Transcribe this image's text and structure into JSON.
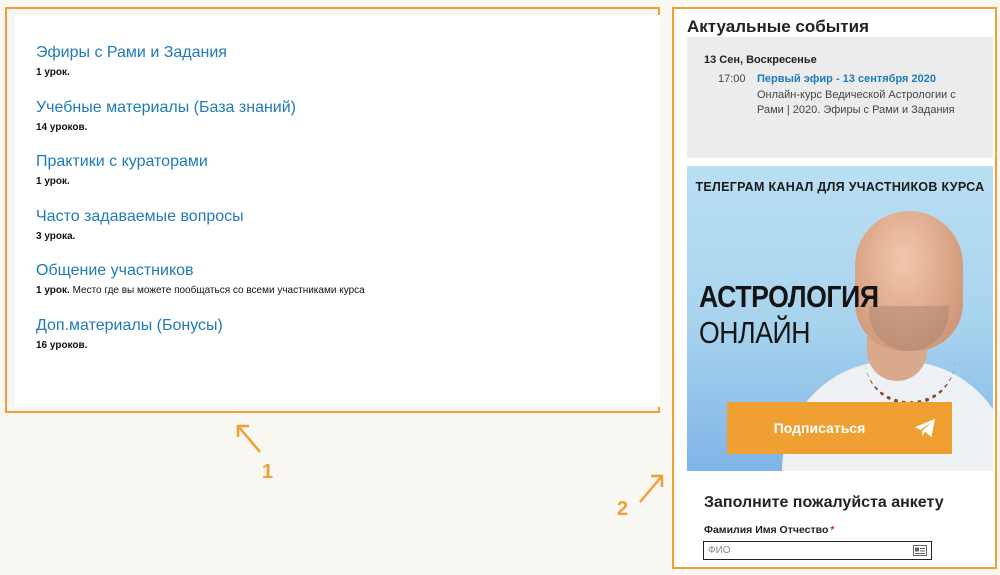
{
  "lessons": [
    {
      "title": "Эфиры с Рами и Задания",
      "count": "1 урок.",
      "desc": ""
    },
    {
      "title": "Учебные материалы (База знаний)",
      "count": "14 уроков.",
      "desc": ""
    },
    {
      "title": "Практики с кураторами",
      "count": "1 урок.",
      "desc": ""
    },
    {
      "title": "Часто задаваемые вопросы",
      "count": "3 урока.",
      "desc": ""
    },
    {
      "title": "Общение участников",
      "count": "1 урок.",
      "desc": "Место где вы можете пообщаться со всеми участниками курса"
    },
    {
      "title": "Доп.материалы (Бонусы)",
      "count": "16 уроков.",
      "desc": ""
    }
  ],
  "events": {
    "title": "Актуальные события",
    "date": "13 Сен, Воскресенье",
    "time": "17:00",
    "link": "Первый эфир - 13 сентября 2020",
    "description": "Онлайн-курс Ведической Астрологии с Рами | 2020. Эфиры с Рами и Задания"
  },
  "banner": {
    "heading": "ТЕЛЕГРАМ КАНАЛ ДЛЯ УЧАСТНИКОВ КУРСА",
    "brand_line1": "АСТРОЛОГИЯ",
    "brand_line2": "ОНЛАЙН",
    "button_label": "Подписаться"
  },
  "form": {
    "title": "Заполните пожалуйста анкету",
    "field_label": "Фамилия Имя Отчество",
    "required_mark": "*",
    "placeholder": "ФИО"
  },
  "annotations": {
    "one": "1",
    "two": "2"
  },
  "colors": {
    "accent": "#f0a033",
    "link": "#1f7ab8",
    "telegram": "#ffffff"
  },
  "icons": {
    "telegram": "telegram-icon",
    "contact_card": "contact-card-icon"
  }
}
